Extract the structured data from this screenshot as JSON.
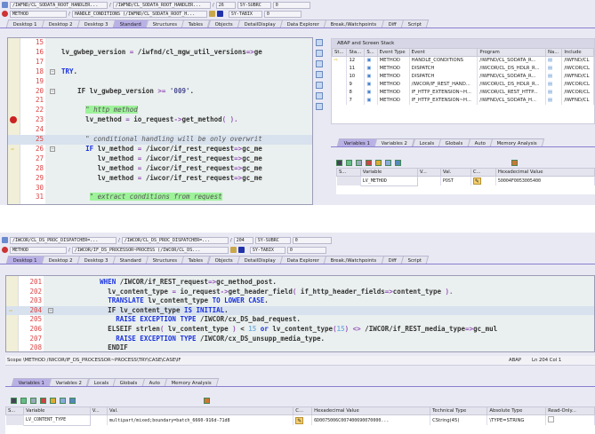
{
  "top": {
    "program_field": "/IWFND/CL_SODATA_ROOT_HANDLER...",
    "include_field": "/IWFND/CL_SODATA_ROOT_HANDLER...",
    "line_field": "26",
    "event_type": "METHOD",
    "event_field": "HANDLE_CONDITIONS (/IWFND/CL_SODATA_ROOT_H...",
    "sy_subrc_label": "SY-SUBRC",
    "sy_subrc": "0",
    "sy_tabix_label": "SY-TABIX",
    "sy_tabix": "0",
    "slash": "/",
    "tabs": [
      "Desktop 1",
      "Desktop 2",
      "Desktop 3",
      "Standard",
      "Structures",
      "Tables",
      "Objects",
      "DetailDisplay",
      "Data Explorer",
      "Break./Watchpoints",
      "Diff",
      "Script"
    ],
    "active_tab": "Standard",
    "code": [
      {
        "n": "15",
        "t": []
      },
      {
        "n": "16",
        "t": [
          [
            "lv_gwbep_version ",
            ""
          ],
          [
            "=",
            "op"
          ],
          [
            " /iwfnd/cl_mgw_util_versions",
            ""
          ],
          [
            "=>",
            "op"
          ],
          [
            "ge",
            ""
          ]
        ]
      },
      {
        "n": "17",
        "t": []
      },
      {
        "n": "18",
        "fold": true,
        "t": [
          [
            "TRY",
            "kw"
          ],
          [
            ".",
            ""
          ]
        ]
      },
      {
        "n": "19",
        "t": []
      },
      {
        "n": "20",
        "fold": true,
        "t": [
          [
            "    IF lv_gwbep_version ",
            ""
          ],
          [
            ">=",
            "op"
          ],
          [
            " '009'",
            "str"
          ],
          [
            ".",
            ""
          ]
        ]
      },
      {
        "n": "21",
        "t": []
      },
      {
        "n": "22",
        "t": [
          [
            "      ",
            ""
          ],
          [
            "\" http method",
            "cmt cmtbg"
          ]
        ]
      },
      {
        "n": "23",
        "bp": true,
        "t": [
          [
            "      lv_method ",
            ""
          ],
          [
            "=",
            "op"
          ],
          [
            " io_request",
            ""
          ],
          [
            "->",
            "op"
          ],
          [
            "get_method",
            ""
          ],
          [
            "( ).",
            "op"
          ]
        ]
      },
      {
        "n": "24",
        "t": []
      },
      {
        "n": "25",
        "cur": true,
        "t": [
          [
            "      ",
            ""
          ],
          [
            "\" conditional handling will be only overwrit",
            "cmt"
          ]
        ]
      },
      {
        "n": "26",
        "arrow": true,
        "fold": true,
        "t": [
          [
            "      ",
            ""
          ],
          [
            "IF",
            "kw"
          ],
          [
            " lv_method ",
            ""
          ],
          [
            "=",
            "op"
          ],
          [
            " /iwcor/if_rest_request",
            ""
          ],
          [
            "=>",
            "op"
          ],
          [
            "gc_me",
            ""
          ]
        ]
      },
      {
        "n": "27",
        "t": [
          [
            "         lv_method ",
            ""
          ],
          [
            "=",
            "op"
          ],
          [
            " /iwcor/if_rest_request",
            ""
          ],
          [
            "=>",
            "op"
          ],
          [
            "gc_me",
            ""
          ]
        ]
      },
      {
        "n": "28",
        "t": [
          [
            "         lv_method ",
            ""
          ],
          [
            "=",
            "op"
          ],
          [
            " /iwcor/if_rest_request",
            ""
          ],
          [
            "=>",
            "op"
          ],
          [
            "gc_me",
            ""
          ]
        ]
      },
      {
        "n": "29",
        "t": [
          [
            "         lv_method ",
            ""
          ],
          [
            "=",
            "op"
          ],
          [
            " /iwcor/if_rest_request",
            ""
          ],
          [
            "=>",
            "op"
          ],
          [
            "gc_me",
            ""
          ]
        ]
      },
      {
        "n": "30",
        "t": []
      },
      {
        "n": "31",
        "t": [
          [
            "       ",
            ""
          ],
          [
            "\" extract conditions from request",
            "cmt cmtbg"
          ]
        ]
      }
    ],
    "stack": {
      "title": "ABAP and Screen Stack",
      "columns": [
        "St...",
        "Sta...",
        "S...",
        "Event Type",
        "Event",
        "Program",
        "Na...",
        "Include"
      ],
      "rows": [
        {
          "current": true,
          "level": "12",
          "type": "METHOD",
          "event": "HANDLE_CONDITIONS",
          "program": "/IWFND/CL_SODATA_R...",
          "include": "/IWFND/CL"
        },
        {
          "level": "11",
          "type": "METHOD",
          "event": "DISPATCH",
          "program": "/IWCOR/CL_DS_HDLR_R...",
          "include": "/IWCOR/CL"
        },
        {
          "level": "10",
          "type": "METHOD",
          "event": "DISPATCH",
          "program": "/IWFND/CL_SODATA_R...",
          "include": "/IWFND/CL"
        },
        {
          "level": "9",
          "type": "METHOD",
          "event": "/IWCOR/IF_REST_HAND...",
          "program": "/IWCOR/CL_DS_HDLR_R...",
          "include": "/IWCOR/CL"
        },
        {
          "level": "8",
          "type": "METHOD",
          "event": "IF_HTTP_EXTENSION~H...",
          "program": "/IWCOR/CL_REST_HTTP...",
          "include": "/IWCOR/CL"
        },
        {
          "level": "7",
          "type": "METHOD",
          "event": "IF_HTTP_EXTENSION~H...",
          "program": "/IWFND/CL_SODATA_H...",
          "include": "/IWFND/CL"
        }
      ]
    },
    "var_tabs": [
      "Variables 1",
      "Variables 2",
      "Locals",
      "Globals",
      "Auto",
      "Memory Analysis"
    ],
    "var_columns": [
      "S...",
      "Variable",
      "V...",
      "Val.",
      "C...",
      "Hexadecimal Value"
    ],
    "var_rows": [
      {
        "variable": "LV_METHOD",
        "value": "POST",
        "hex": "50004F0053005400"
      }
    ]
  },
  "bottom": {
    "program_field": "/IWCOR/CL_DS_PROC_DISPATCHER=...",
    "include_field": "/IWCOR/CL_DS_PROC_DISPATCHER=...",
    "line_field": "204",
    "event_type": "METHOD",
    "event_field": "/IWCOR/IF_DS_PROCESSOR~PROCESS (/IWCOR/CL_DS...",
    "sy_subrc_label": "SY-SUBRC",
    "sy_subrc": "0",
    "sy_tabix_label": "SY-TABIX",
    "sy_tabix": "0",
    "slash": "/",
    "tabs": [
      "Desktop 1",
      "Desktop 2",
      "Desktop 3",
      "Standard",
      "Structures",
      "Tables",
      "Objects",
      "DetailDisplay",
      "Data Explorer",
      "Break./Watchpoints",
      "Diff",
      "Script"
    ],
    "active_tab": "Desktop 1",
    "code": [
      {
        "n": "201",
        "t": [
          [
            "          ",
            ""
          ],
          [
            "WHEN",
            "kw"
          ],
          [
            " /IWCOR/if_REST_request",
            ""
          ],
          [
            "=>",
            "op"
          ],
          [
            "gc_method_post.",
            ""
          ]
        ]
      },
      {
        "n": "202",
        "t": [
          [
            "            lv_content_type ",
            ""
          ],
          [
            "=",
            "op"
          ],
          [
            " io_request",
            ""
          ],
          [
            "->",
            "op"
          ],
          [
            "get_header_field",
            ""
          ],
          [
            "(",
            "op"
          ],
          [
            " if_http_header_fields",
            ""
          ],
          [
            "=>",
            "op"
          ],
          [
            "content_type ",
            ""
          ],
          [
            ").",
            "op"
          ]
        ]
      },
      {
        "n": "203",
        "t": [
          [
            "            ",
            ""
          ],
          [
            "TRANSLATE",
            "kw"
          ],
          [
            " lv_content_type ",
            ""
          ],
          [
            "TO LOWER CASE",
            "kw"
          ],
          [
            ".",
            ""
          ]
        ]
      },
      {
        "n": "204",
        "cur": true,
        "arrow": true,
        "fold": true,
        "t": [
          [
            "            IF lv_content_type ",
            ""
          ],
          [
            "IS INITIAL",
            "kw"
          ],
          [
            ".",
            ""
          ]
        ]
      },
      {
        "n": "205",
        "t": [
          [
            "              ",
            ""
          ],
          [
            "RAISE EXCEPTION TYPE",
            "kw"
          ],
          [
            " /IWCOR/cx_DS_bad_request.",
            ""
          ]
        ]
      },
      {
        "n": "206",
        "t": [
          [
            "            ELSEIF strlen",
            ""
          ],
          [
            "(",
            "op"
          ],
          [
            " lv_content_type ",
            ""
          ],
          [
            ")",
            "op"
          ],
          [
            " < ",
            ""
          ],
          [
            "15",
            "nm"
          ],
          [
            " ",
            ""
          ],
          [
            "or",
            "kw"
          ],
          [
            " lv_content_type",
            ""
          ],
          [
            "(",
            "op"
          ],
          [
            "15",
            "nm"
          ],
          [
            ")",
            "op"
          ],
          [
            " ",
            ""
          ],
          [
            "<>",
            "op"
          ],
          [
            " /IWCOR/if_REST_media_type",
            ""
          ],
          [
            "=>",
            "op"
          ],
          [
            "gc_mul",
            ""
          ]
        ]
      },
      {
        "n": "207",
        "t": [
          [
            "              ",
            ""
          ],
          [
            "RAISE EXCEPTION TYPE",
            "kw"
          ],
          [
            " /IWCOR/cx_DS_unsupp_media_type.",
            ""
          ]
        ]
      },
      {
        "n": "208",
        "t": [
          [
            "            ENDIF",
            ""
          ]
        ]
      }
    ],
    "scope": "Scope \\METHOD /IWCOR/IF_DS_PROCESSOR~PROCESS\\TRY\\CASE\\CASE\\IF",
    "lang": "ABAP",
    "position": "Ln 204 Col  1",
    "var_tabs": [
      "Variables 1",
      "Variables 2",
      "Locals",
      "Globals",
      "Auto",
      "Memory Analysis"
    ],
    "var_columns": [
      "S...",
      "Variable",
      "V...",
      "Val.",
      "C...",
      "Hexadecimal Value",
      "Technical Type",
      "Absolute Type",
      "Read-Only..."
    ],
    "var_rows": [
      {
        "variable": "LV_CONTENT_TYPE",
        "value": "multipart/mixed;boundary=batch_6660-916d-71d8",
        "hex": "6D0075006C007400690070000...",
        "tech": "CString(45)",
        "abs": "\\TYPE=STRING"
      }
    ]
  }
}
